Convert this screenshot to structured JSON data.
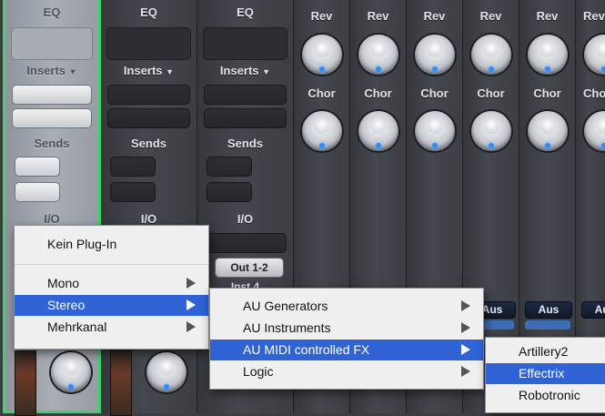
{
  "strips": {
    "eq_label": "EQ",
    "inserts_label": "Inserts",
    "sends_label": "Sends",
    "io_label": "I/O",
    "rev_label": "Rev",
    "chor_label": "Chor",
    "output_label": "Out 1-2",
    "aus_label": "Aus",
    "inst_label": "Inst 4",
    "selected_color": "#3cd36a"
  },
  "menu_main": {
    "items": [
      {
        "label": "Kein Plug-In"
      },
      {
        "label": "Mono"
      },
      {
        "label": "Stereo"
      },
      {
        "label": "Mehrkanal"
      }
    ]
  },
  "menu_stereo": {
    "items": [
      {
        "label": "AU Generators"
      },
      {
        "label": "AU Instruments"
      },
      {
        "label": "AU MIDI controlled FX"
      },
      {
        "label": "Logic"
      }
    ]
  },
  "menu_fx": {
    "items": [
      {
        "label": "Artillery2"
      },
      {
        "label": "Effectrix"
      },
      {
        "label": "Robotronic"
      }
    ]
  },
  "highlight_color": "#2f63d6"
}
